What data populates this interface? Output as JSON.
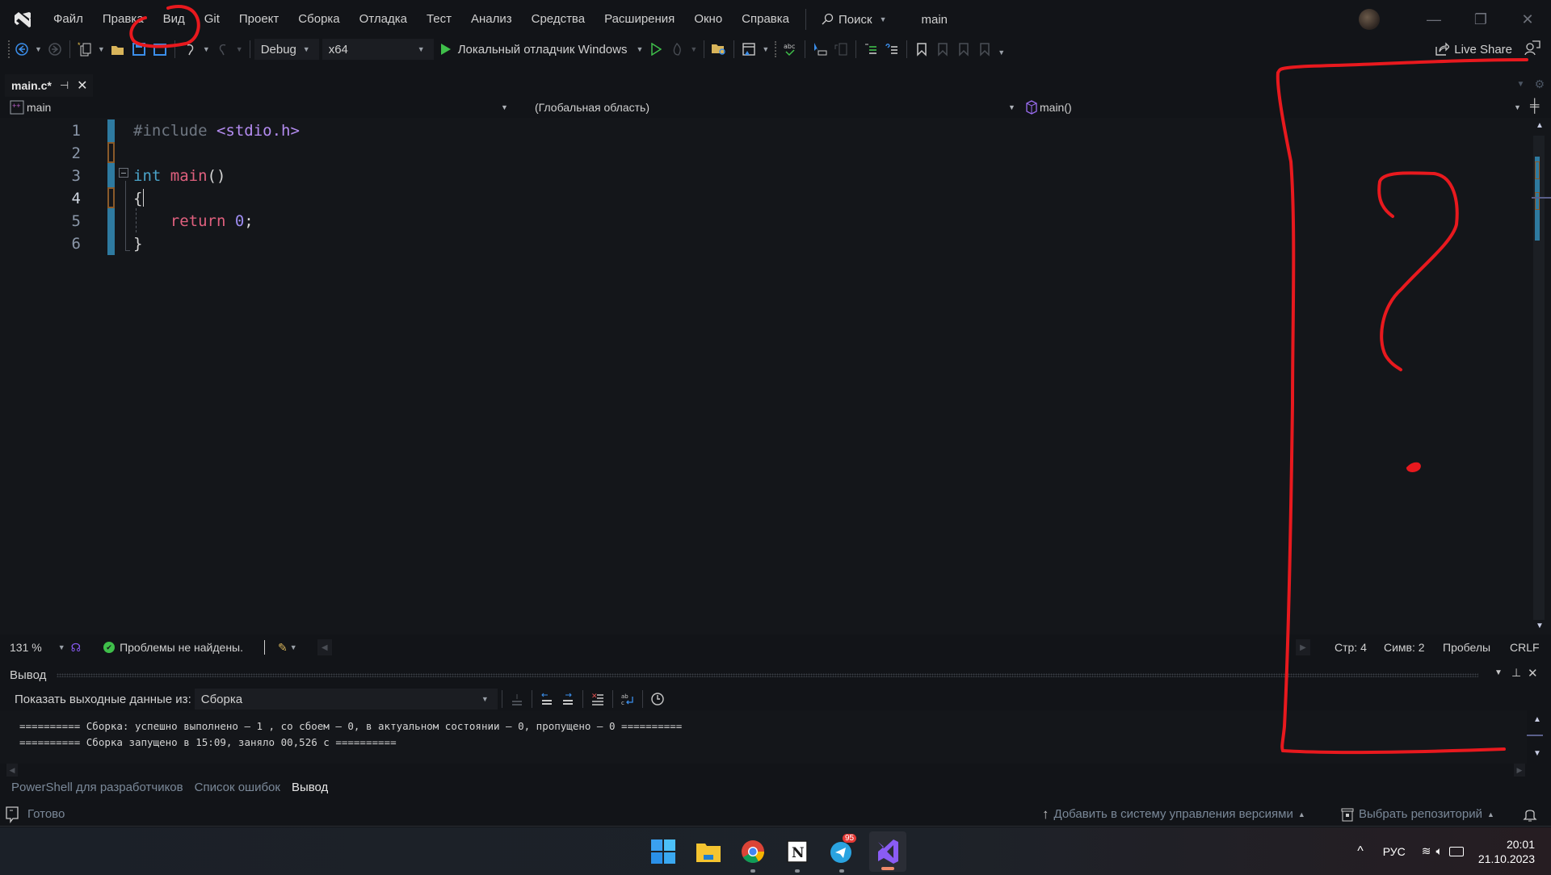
{
  "menu": {
    "items": [
      "Файл",
      "Правка",
      "Вид",
      "Git",
      "Проект",
      "Сборка",
      "Отладка",
      "Тест",
      "Анализ",
      "Средства",
      "Расширения",
      "Окно",
      "Справка"
    ],
    "search_label": "Поиск",
    "solution_name": "main"
  },
  "toolbar": {
    "configuration": "Debug",
    "platform": "x64",
    "debugger_label": "Локальный отладчик Windows",
    "live_share_label": "Live Share"
  },
  "document": {
    "tab_label": "main.c*",
    "nav_project": "main",
    "nav_scope": "(Глобальная область)",
    "nav_member": "main()"
  },
  "code": {
    "lines": [
      {
        "num": "1",
        "tokens": [
          {
            "t": "#include ",
            "c": "tok-pre"
          },
          {
            "t": "<stdio.h>",
            "c": "tok-inc"
          }
        ]
      },
      {
        "num": "2",
        "tokens": []
      },
      {
        "num": "3",
        "tokens": [
          {
            "t": "int ",
            "c": "tok-kw"
          },
          {
            "t": "main",
            "c": "tok-fn"
          },
          {
            "t": "()",
            "c": "tok-plain"
          }
        ]
      },
      {
        "num": "4",
        "tokens": [
          {
            "t": "{",
            "c": "tok-plain"
          }
        ]
      },
      {
        "num": "5",
        "tokens": [
          {
            "t": "    ",
            "c": "tok-plain"
          },
          {
            "t": "return ",
            "c": "tok-fn"
          },
          {
            "t": "0",
            "c": "tok-num"
          },
          {
            "t": ";",
            "c": "tok-plain"
          }
        ]
      },
      {
        "num": "6",
        "tokens": [
          {
            "t": "}",
            "c": "tok-plain"
          }
        ]
      }
    ],
    "current_line": 4
  },
  "editor_status": {
    "zoom": "131 %",
    "issues": "Проблемы не найдены.",
    "line": "Стр: 4",
    "col": "Симв: 2",
    "indent": "Пробелы",
    "eol": "CRLF"
  },
  "output": {
    "title": "Вывод",
    "source_label": "Показать выходные данные из:",
    "source_value": "Сборка",
    "lines": [
      "========== Сборка: успешно выполнено — 1 , со сбоем — 0, в актуальном состоянии — 0, пропущено — 0 ==========",
      "========== Сборка запущено в 15:09, заняло 00,526 с =========="
    ]
  },
  "tool_tabs": [
    {
      "label": "PowerShell для разработчиков",
      "active": false
    },
    {
      "label": "Список ошибок",
      "active": false
    },
    {
      "label": "Вывод",
      "active": true
    }
  ],
  "statusbar": {
    "ready": "Готово",
    "add_source_control": "Добавить в систему управления версиями",
    "select_repo": "Выбрать репозиторий"
  },
  "taskbar": {
    "telegram_badge": "95",
    "lang": "РУС",
    "time": "20:01",
    "date": "21.10.2023"
  },
  "colors": {
    "annotation": "#e8191e",
    "vs_purple": "#8a5cf5",
    "change_saved": "#2e7aa0",
    "change_unsaved": "#8a5a2a"
  }
}
